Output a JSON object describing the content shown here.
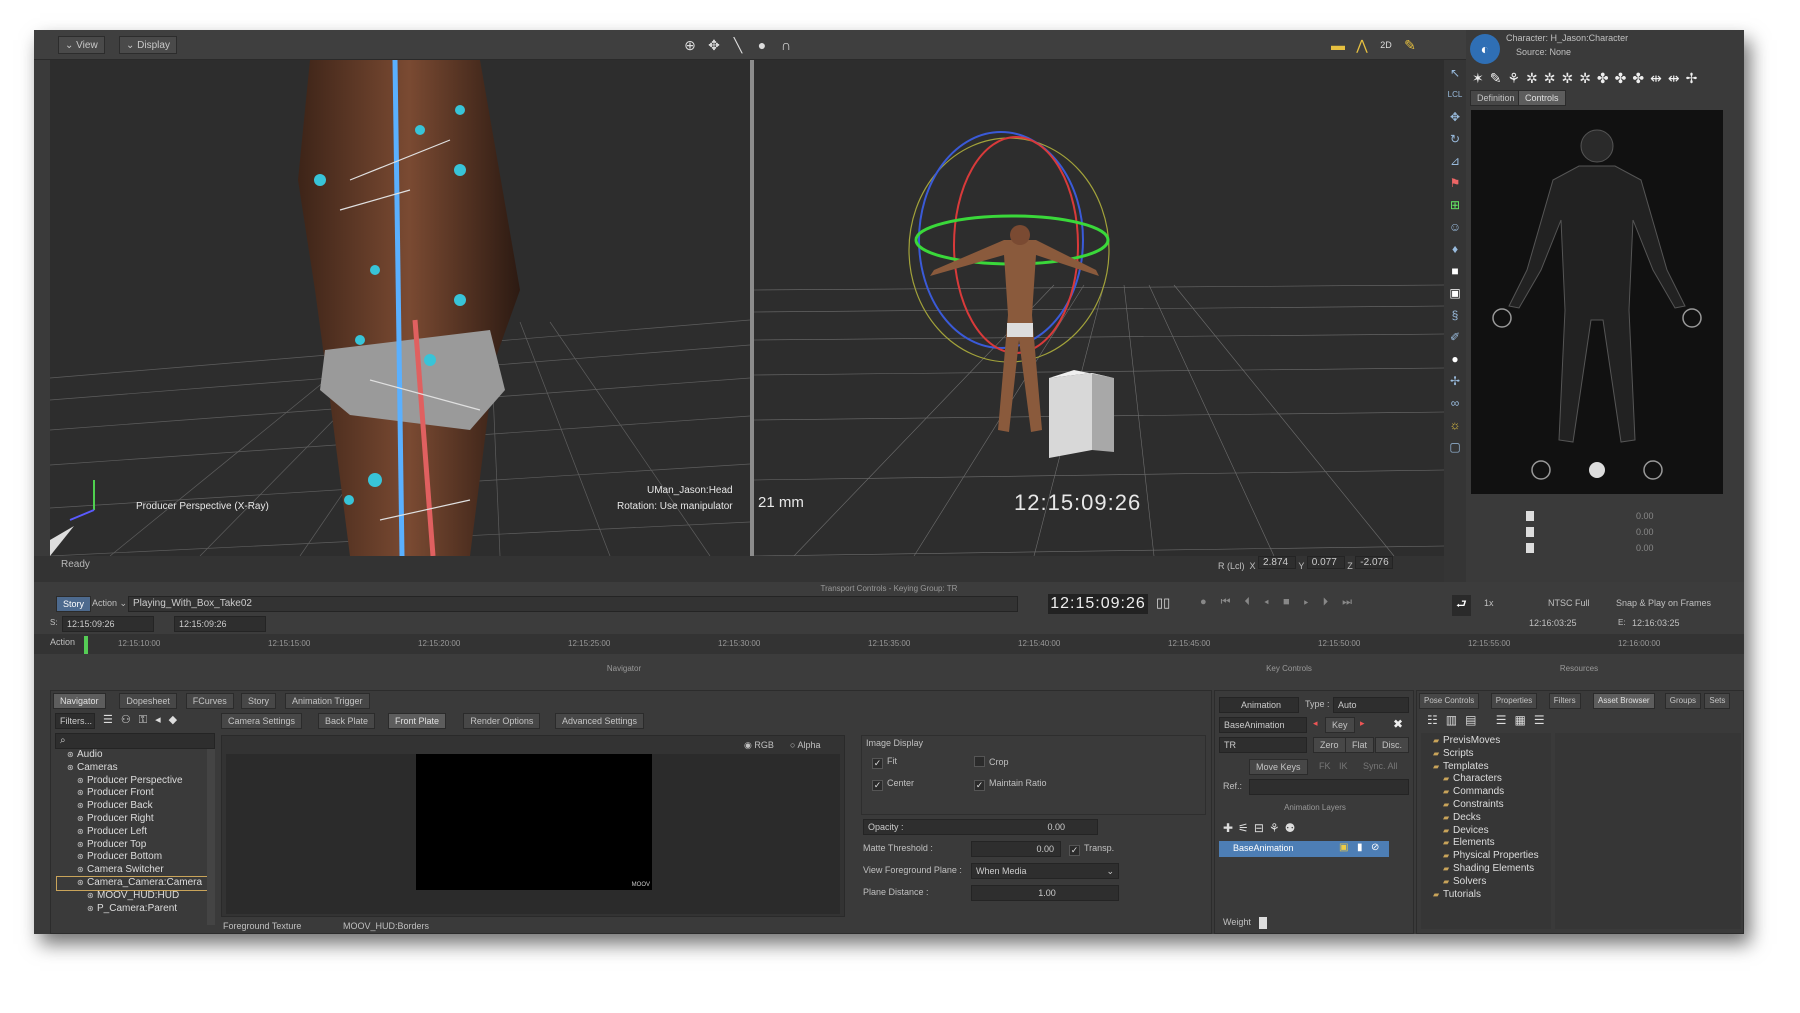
{
  "topbar": {
    "view_label": "View",
    "display_label": "Display"
  },
  "left_viewport": {
    "camera_label": "Producer Perspective (X-Ray)",
    "object_name": "UMan_Jason:Head",
    "rotation_text": "Rotation: Use manipulator"
  },
  "right_viewport": {
    "lens": "21 mm",
    "timecode": "12:15:09:26"
  },
  "character_panel": {
    "character_label": "Character:",
    "character_value": "H_Jason:Character",
    "source_label": "Source:",
    "source_value": "None",
    "tabs": [
      "Definition",
      "Controls"
    ],
    "slider_values": [
      "0.00",
      "0.00",
      "0.00"
    ]
  },
  "status": {
    "text": "Ready",
    "coords": {
      "label": "R (Lcl)",
      "x_label": "X",
      "x": "2.874",
      "y_label": "Y",
      "y": "0.077",
      "z_label": "Z",
      "z": "-2.076"
    }
  },
  "transport": {
    "header": "Transport Controls - Keying Group: TR",
    "story_label": "Story",
    "action_label": "Action",
    "take_name": "Playing_With_Box_Take02",
    "big_timecode": "12:15:09:26",
    "speed": "1x",
    "fps": "NTSC Full",
    "snap": "Snap & Play on Frames",
    "start_label": "S:",
    "start_value": "12:15:09:26",
    "current_value": "12:15:09:26",
    "end_value": "12:16:03:25",
    "end_label": "E:",
    "end_value2": "12:16:03:25",
    "action_row_label": "Action",
    "ticks": [
      "12:15:10:00",
      "12:15:15:00",
      "12:15:20:00",
      "12:15:25:00",
      "12:15:30:00",
      "12:15:35:00",
      "12:15:40:00",
      "12:15:45:00",
      "12:15:50:00",
      "12:15:55:00",
      "12:16:00:00"
    ]
  },
  "navigator": {
    "title": "Navigator",
    "tabs": [
      "Navigator",
      "Dopesheet",
      "FCurves",
      "Story",
      "Animation Trigger"
    ],
    "filters_label": "Filters...",
    "tree": [
      {
        "label": "Audio",
        "indent": 1
      },
      {
        "label": "Cameras",
        "indent": 1
      },
      {
        "label": "Producer Perspective",
        "indent": 2
      },
      {
        "label": "Producer Front",
        "indent": 2
      },
      {
        "label": "Producer Back",
        "indent": 2
      },
      {
        "label": "Producer Right",
        "indent": 2
      },
      {
        "label": "Producer Left",
        "indent": 2
      },
      {
        "label": "Producer Top",
        "indent": 2
      },
      {
        "label": "Producer Bottom",
        "indent": 2
      },
      {
        "label": "Camera Switcher",
        "indent": 2
      },
      {
        "label": "Camera_Camera:Camera",
        "indent": 2
      },
      {
        "label": "MOOV_HUD:HUD",
        "indent": 3
      },
      {
        "label": "P_Camera:Parent",
        "indent": 3
      }
    ],
    "sub_tabs": [
      "Camera Settings",
      "Back Plate",
      "Front Plate",
      "Render Options",
      "Advanced Settings"
    ],
    "rgb_label": "RGB",
    "alpha_label": "Alpha",
    "preview_watermark": "MOOV",
    "fg_texture_label": "Foreground Texture",
    "fg_texture_value": "MOOV_HUD:Borders",
    "image_display": {
      "title": "Image Display",
      "fit": "Fit",
      "crop": "Crop",
      "center": "Center",
      "maintain_ratio": "Maintain Ratio",
      "opacity_label": "Opacity :",
      "opacity_value": "0.00",
      "matte_label": "Matte Threshold :",
      "matte_value": "0.00",
      "transp_label": "Transp.",
      "view_fg_label": "View Foreground Plane :",
      "view_fg_value": "When Media",
      "plane_dist_label": "Plane Distance :",
      "plane_dist_value": "1.00"
    }
  },
  "key_controls": {
    "title": "Key Controls",
    "animation_label": "Animation",
    "type_label": "Type :",
    "type_value": "Auto",
    "layer_value": "BaseAnimation",
    "key_label": "Key",
    "tr_value": "TR",
    "zero": "Zero",
    "flat": "Flat",
    "disc": "Disc.",
    "move_keys": "Move Keys",
    "fk": "FK",
    "ik": "IK",
    "sync": "Sync. All",
    "ref_label": "Ref.:",
    "layers_title": "Animation Layers",
    "layer_item": "BaseAnimation",
    "weight_label": "Weight"
  },
  "resources": {
    "title": "Resources",
    "tabs": [
      "Pose Controls",
      "Properties",
      "Filters",
      "Asset Browser",
      "Groups",
      "Sets"
    ],
    "tree": [
      {
        "label": "PrevisMoves",
        "indent": 1
      },
      {
        "label": "Scripts",
        "indent": 1
      },
      {
        "label": "Templates",
        "indent": 1
      },
      {
        "label": "Characters",
        "indent": 2
      },
      {
        "label": "Commands",
        "indent": 2
      },
      {
        "label": "Constraints",
        "indent": 2
      },
      {
        "label": "Decks",
        "indent": 2
      },
      {
        "label": "Devices",
        "indent": 2
      },
      {
        "label": "Elements",
        "indent": 2
      },
      {
        "label": "Physical Properties",
        "indent": 2
      },
      {
        "label": "Shading Elements",
        "indent": 2
      },
      {
        "label": "Solvers",
        "indent": 2
      },
      {
        "label": "Tutorials",
        "indent": 1
      }
    ]
  }
}
